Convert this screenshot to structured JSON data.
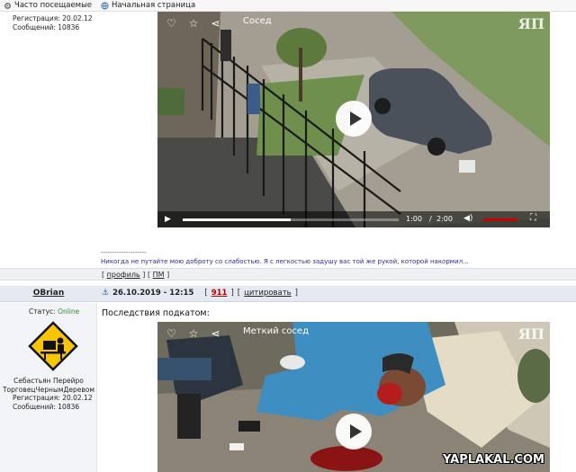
{
  "bookmarks": {
    "items": [
      {
        "label": "Часто посещаемые",
        "icon": "gear-icon"
      },
      {
        "label": "Начальная страница",
        "icon": "globe-icon"
      }
    ]
  },
  "post1": {
    "registration": "Регистрация: 20.02.12",
    "messages": "Сообщений: 10836",
    "video": {
      "title": "Сосед",
      "time_current": "1:00",
      "time_separator": "/",
      "time_total": "2:00",
      "progress": 0.5,
      "channel_logo": "ЯП"
    },
    "signature_separator": "--------------------",
    "signature": "Никогда не путайте мою доброту со слабостью. Я с легкостью задушу вас той же рукой, которой накормил..."
  },
  "post_footer": {
    "profile": "профиль",
    "pm": "ПМ"
  },
  "post2": {
    "username": "OBrian",
    "date": "26.10.2019 - 12:15",
    "rating": "911",
    "quote": "цитировать",
    "status_label": "Статус:",
    "status_value": "Online",
    "user_title_line1": "Себастьян Перейро",
    "user_title_line2": "ТорговецЧернымДеревом",
    "registration": "Регистрация: 20.02.12",
    "messages": "Сообщений: 10836",
    "body_text": "Последствия подкатом:",
    "video": {
      "title": "Меткий сосед",
      "channel_logo": "ЯП",
      "watermark": "YAPLAKAL.COM"
    }
  },
  "colors": {
    "online": "#2e8b2e",
    "rating": "#c00000",
    "link_sig": "#2a2aa6",
    "header_bg": "#e5e9f2"
  }
}
